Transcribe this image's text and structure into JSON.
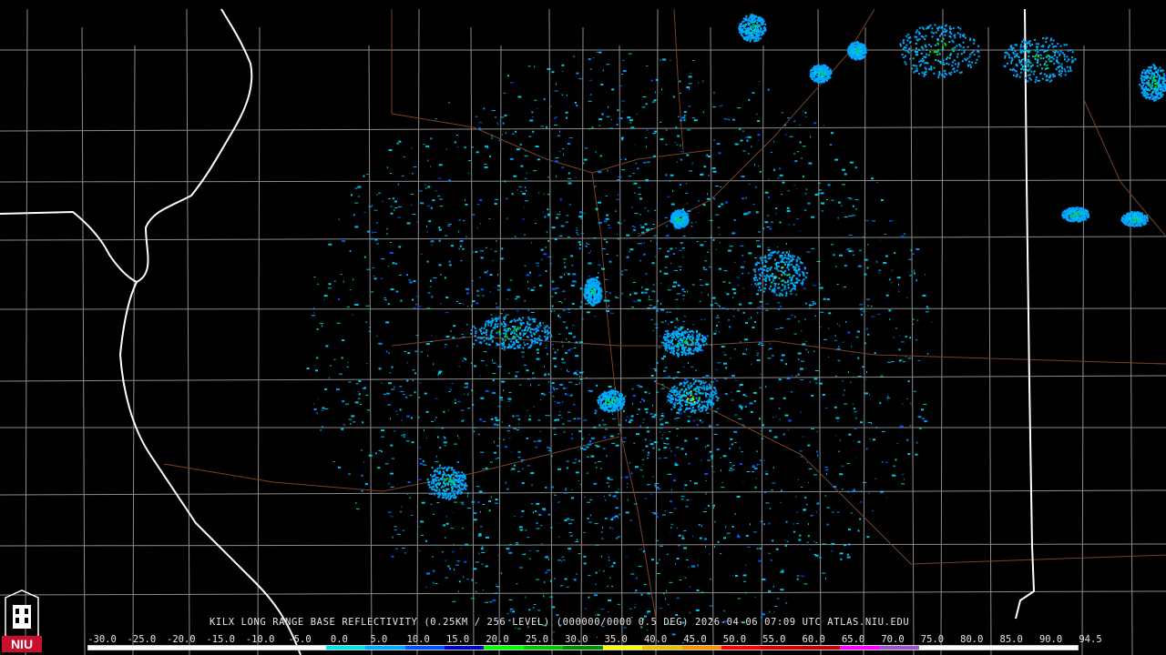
{
  "caption": "KILX LONG RANGE BASE REFLECTIVITY (0.25KM / 256 LEVEL) (000000/0000 0.5 DEG) 2026-04-06 07:09 UTC  ATLAS.NIU.EDU",
  "logo": {
    "text": "NIU",
    "colors": {
      "main": "#c8102e",
      "accent": "#ffffff"
    }
  },
  "scale": {
    "labels": [
      "-30.0",
      "-25.0",
      "-20.0",
      "-15.0",
      "-10.0",
      "-5.0",
      "0.0",
      "5.0",
      "10.0",
      "15.0",
      "20.0",
      "25.0",
      "30.0",
      "35.0",
      "40.0",
      "45.0",
      "50.0",
      "55.0",
      "60.0",
      "65.0",
      "70.0",
      "75.0",
      "80.0",
      "85.0",
      "90.0",
      "94.5"
    ],
    "colors": [
      "#ffffff",
      "#ffffff",
      "#ffffff",
      "#ffffff",
      "#ffffff",
      "#ffffff",
      "#00e5e5",
      "#00a8ff",
      "#0050ff",
      "#0000c8",
      "#00ff00",
      "#00c800",
      "#008c00",
      "#ffff00",
      "#e7c000",
      "#ff9000",
      "#ff0000",
      "#d60000",
      "#c00000",
      "#ff00ff",
      "#9955c9",
      "#ffffff",
      "#ffffff",
      "#ffffff",
      "#ffffff"
    ]
  },
  "map_colors": {
    "county": "#9a9a9a",
    "state": "#ffffff",
    "road": "#8a4a2a"
  }
}
